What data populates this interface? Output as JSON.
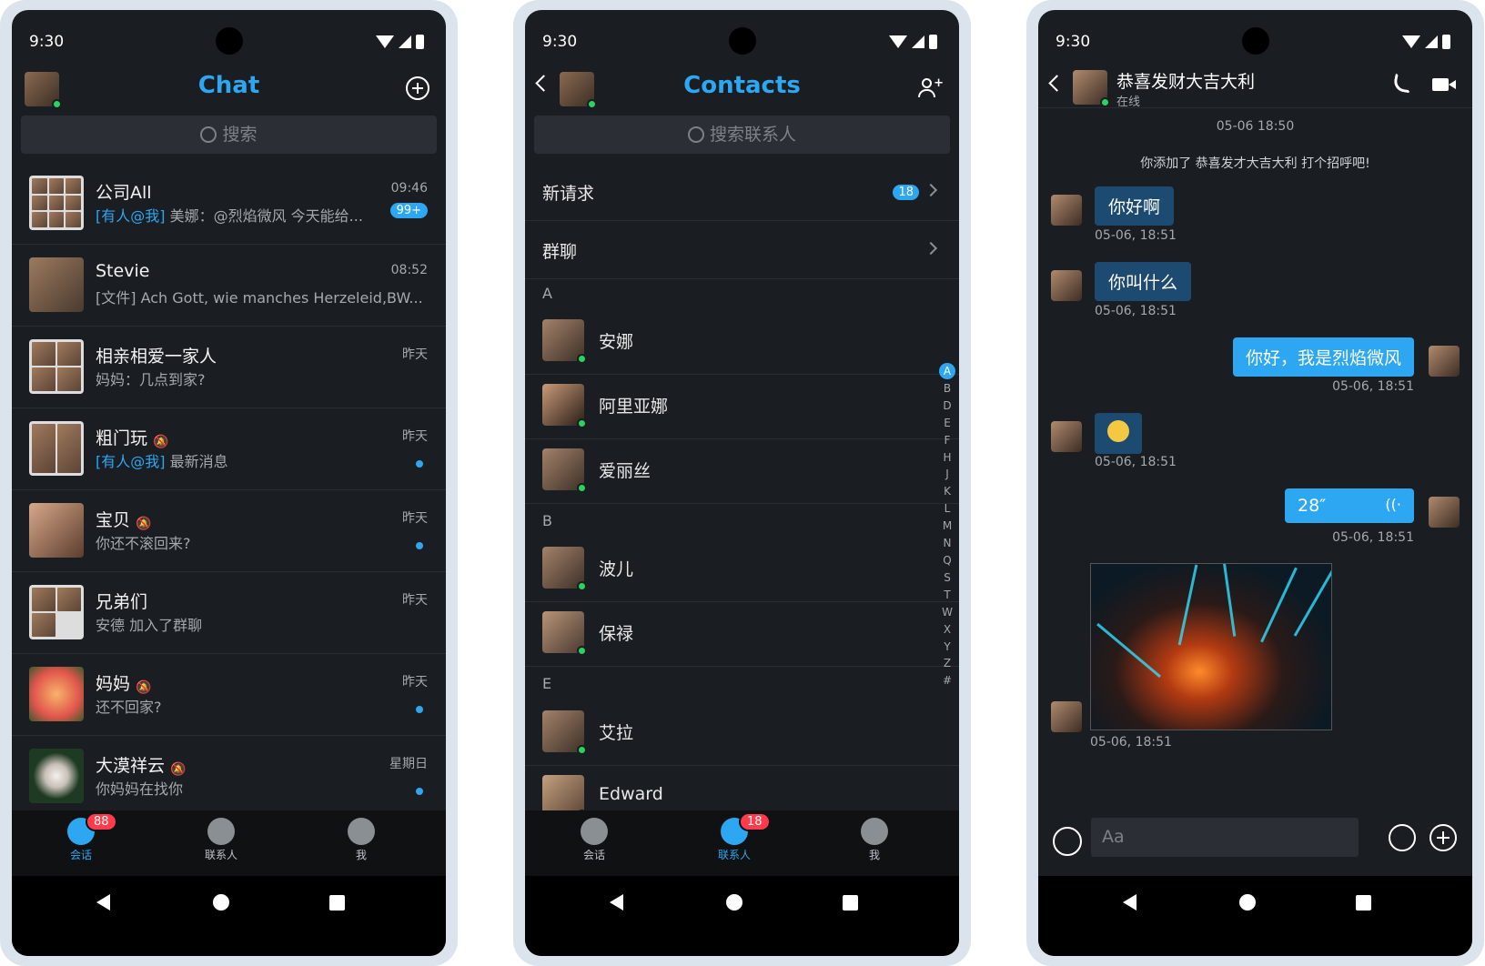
{
  "status": {
    "time": "9:30"
  },
  "chat_screen": {
    "title": "Chat",
    "search_placeholder": "搜索",
    "conversations": [
      {
        "name": "公司All",
        "time": "09:46",
        "mention": "[有人@我]",
        "preview": "美娜：@烈焰微风 今天能给...",
        "badge": "99+"
      },
      {
        "name": "Stevie",
        "time": "08:52",
        "mention": "",
        "preview": "[文件] Ach Gott, wie manches Herzeleid,BW...",
        "badge": ""
      },
      {
        "name": "相亲相爱一家人",
        "time": "昨天",
        "mention": "",
        "preview": "妈妈：几点到家?",
        "badge": ""
      },
      {
        "name": "粗门玩",
        "time": "昨天",
        "mention": "[有人@我]",
        "preview": "最新消息",
        "badge": ""
      },
      {
        "name": "宝贝",
        "time": "昨天",
        "mention": "",
        "preview": "你还不滚回来?",
        "badge": ""
      },
      {
        "name": "兄弟们",
        "time": "昨天",
        "mention": "",
        "preview": "安德 加入了群聊",
        "badge": ""
      },
      {
        "name": "妈妈",
        "time": "昨天",
        "mention": "",
        "preview": "还不回家?",
        "badge": ""
      },
      {
        "name": "大漠祥云",
        "time": "星期日",
        "mention": "",
        "preview": "你妈妈在找你",
        "badge": ""
      }
    ],
    "tabs": [
      {
        "label": "会话",
        "badge": "88"
      },
      {
        "label": "联系人"
      },
      {
        "label": "我"
      }
    ]
  },
  "contacts_screen": {
    "title": "Contacts",
    "search_placeholder": "搜索联系人",
    "new_requests": "新请求",
    "new_requests_count": "18",
    "group_chats": "群聊",
    "sections": {
      "a": "A",
      "b": "B",
      "e": "E"
    },
    "contacts_a": [
      "安娜",
      "阿里亚娜",
      "爱丽丝"
    ],
    "contacts_b": [
      "波儿",
      "保禄"
    ],
    "contacts_e": [
      "艾拉",
      "Edward"
    ],
    "alphabet": [
      "A",
      "B",
      "D",
      "E",
      "F",
      "H",
      "J",
      "K",
      "L",
      "M",
      "N",
      "Q",
      "S",
      "T",
      "W",
      "X",
      "Y",
      "Z",
      "#"
    ],
    "tabs": [
      {
        "label": "会话"
      },
      {
        "label": "联系人",
        "badge": "18"
      },
      {
        "label": "我"
      }
    ]
  },
  "conversation_screen": {
    "name": "恭喜发财大吉大利",
    "status": "在线",
    "date": "05-06 18:50",
    "system_message": "你添加了 恭喜发才大吉大利 打个招呼吧!",
    "messages": [
      {
        "dir": "in",
        "text": "你好啊",
        "time": "05-06, 18:51"
      },
      {
        "dir": "in",
        "text": "你叫什么",
        "time": "05-06, 18:51"
      },
      {
        "dir": "out",
        "text": "你好，我是烈焰微风",
        "time": "05-06, 18:51"
      },
      {
        "dir": "in",
        "text": "",
        "time": "05-06, 18:51"
      },
      {
        "dir": "out",
        "text": "28″",
        "time": "05-06, 18:51"
      },
      {
        "dir": "in",
        "text": "",
        "time": "05-06, 18:51"
      }
    ],
    "input_placeholder": "Aa"
  }
}
